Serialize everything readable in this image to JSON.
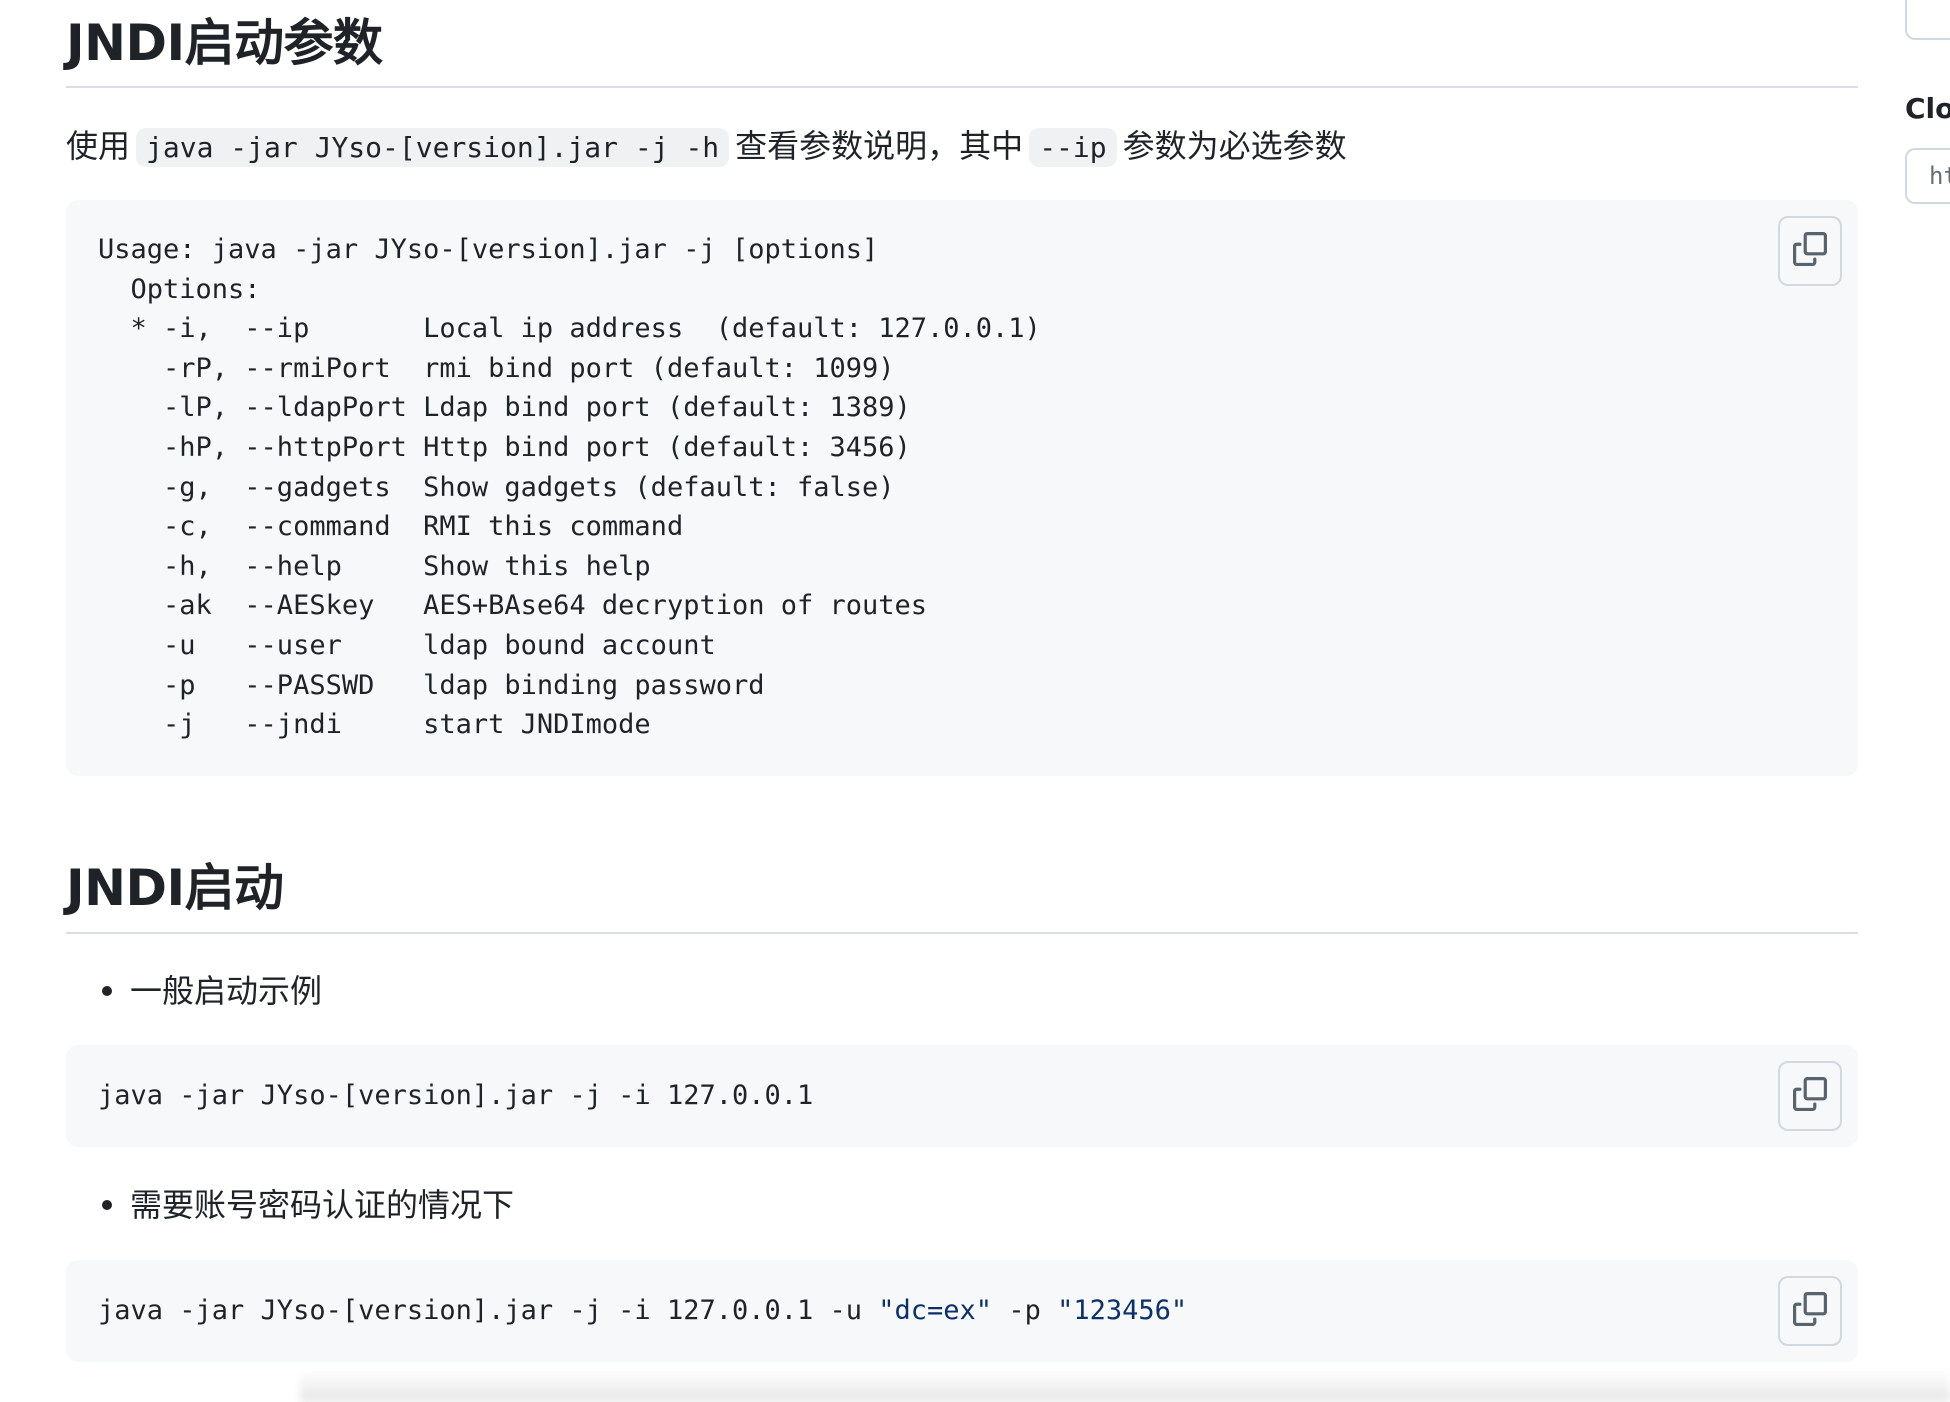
{
  "section_params": {
    "heading": "JNDI启动参数",
    "intro_prefix": "使用",
    "intro_code": "java -jar JYso-[version].jar -j -h",
    "intro_middle": "查看参数说明，其中",
    "intro_code2": "--ip",
    "intro_suffix": "参数为必选参数",
    "usage_block": "Usage: java -jar JYso-[version].jar -j [options]\n  Options:\n  * -i,  --ip       Local ip address  (default: 127.0.0.1)\n    -rP, --rmiPort  rmi bind port (default: 1099)\n    -lP, --ldapPort Ldap bind port (default: 1389)\n    -hP, --httpPort Http bind port (default: 3456)\n    -g,  --gadgets  Show gadgets (default: false)\n    -c,  --command  RMI this command\n    -h,  --help     Show this help\n    -ak  --AESkey   AES+BAse64 decryption of routes\n    -u   --user     ldap bound account\n    -p   --PASSWD   ldap binding password\n    -j   --jndi     start JNDImode"
  },
  "section_start": {
    "heading": "JNDI启动",
    "bullet1": "一般启动示例",
    "example1": "java -jar JYso-[version].jar -j -i 127.0.0.1",
    "bullet2": "需要账号密码认证的情况下",
    "example2_prefix": "java -jar JYso-[version].jar -j -i 127.0.0.1 -u ",
    "example2_user": "\"dc=ex\"",
    "example2_mid": " -p ",
    "example2_pass": "\"123456\""
  },
  "right_rail": {
    "label": "Clo",
    "input_value": "ht"
  },
  "icons": {
    "copy": "copy-icon"
  }
}
